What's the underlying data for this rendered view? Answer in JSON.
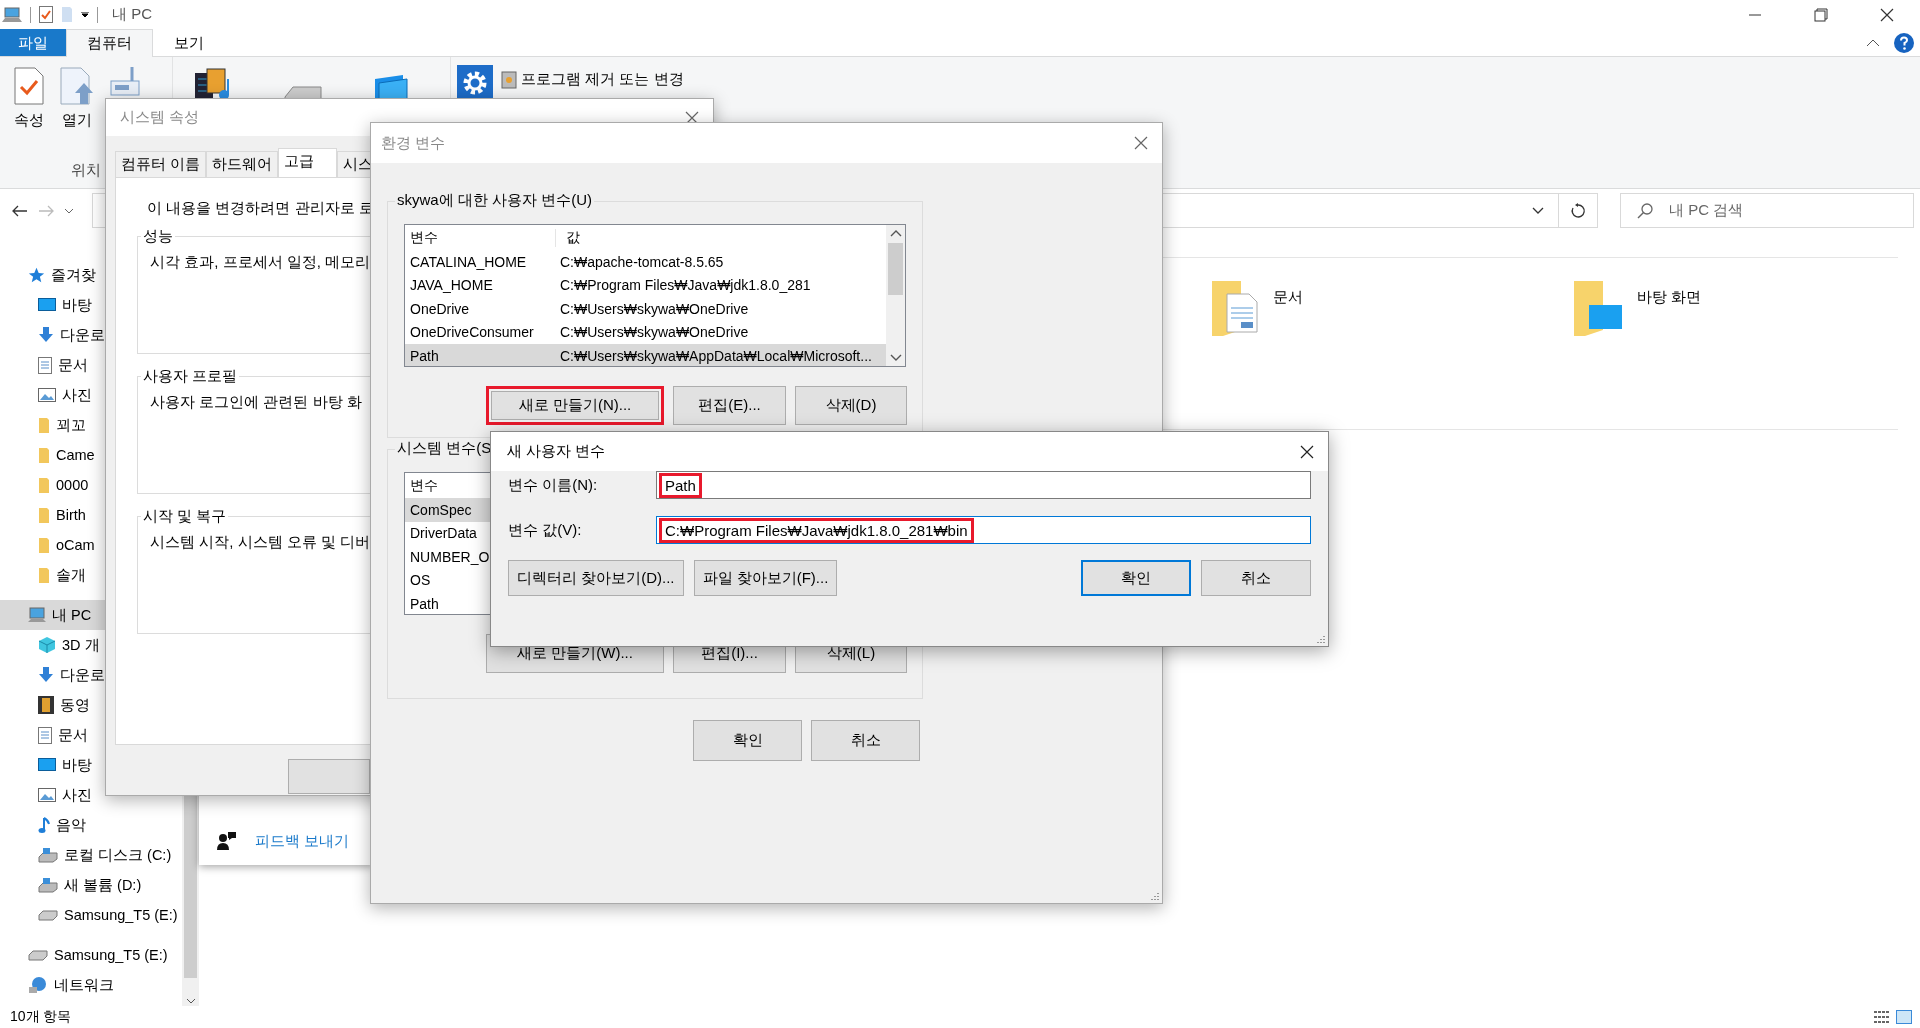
{
  "explorer": {
    "title": "내 PC",
    "ribbon_tabs": [
      {
        "label": "파일",
        "kind": "file",
        "selected": false
      },
      {
        "label": "컴퓨터",
        "kind": "tab",
        "selected": true
      },
      {
        "label": "보기",
        "kind": "tab",
        "selected": false
      }
    ],
    "ribbon_buttons": [
      {
        "label": "속성",
        "kind": "properties"
      },
      {
        "label": "열기",
        "kind": "open"
      }
    ],
    "ribbon_group_label": "위치",
    "ribbon_link": "프로그램 제거 또는 변경",
    "search": {
      "placeholder": "내 PC 검색"
    },
    "sidebar": [
      {
        "label": "즐겨찾",
        "kind": "star",
        "selected": false,
        "children": [
          {
            "label": "바탕",
            "kind": "desktop",
            "selected": false
          },
          {
            "label": "다운로",
            "kind": "download",
            "selected": false
          },
          {
            "label": "문서",
            "kind": "document",
            "selected": false
          },
          {
            "label": "사진",
            "kind": "pictures",
            "selected": false
          },
          {
            "label": "꾀꼬",
            "kind": "folder",
            "selected": false
          },
          {
            "label": "Came",
            "kind": "folder",
            "selected": false
          },
          {
            "label": "0000",
            "kind": "folder",
            "selected": false
          },
          {
            "label": "Birth",
            "kind": "folder",
            "selected": false
          },
          {
            "label": "oCam",
            "kind": "folder",
            "selected": false
          },
          {
            "label": "솔개",
            "kind": "folder",
            "selected": false
          }
        ]
      },
      {
        "label": "내 PC",
        "kind": "pc",
        "selected": true,
        "children": [
          {
            "label": "3D 개",
            "kind": "cube",
            "selected": false
          },
          {
            "label": "다운로",
            "kind": "download",
            "selected": false
          },
          {
            "label": "동영",
            "kind": "video",
            "selected": false
          },
          {
            "label": "문서",
            "kind": "document",
            "selected": false
          },
          {
            "label": "바탕",
            "kind": "desktop",
            "selected": false
          },
          {
            "label": "사진",
            "kind": "pictures",
            "selected": false
          },
          {
            "label": "음악",
            "kind": "music",
            "selected": false
          },
          {
            "label": "로컬 디스크 (C:)",
            "kind": "disk",
            "selected": false
          },
          {
            "label": "새 볼륨 (D:)",
            "kind": "disk",
            "selected": false
          },
          {
            "label": "Samsung_T5 (E:)",
            "kind": "usb",
            "selected": false
          }
        ]
      },
      {
        "label": "Samsung_T5 (E:)",
        "kind": "usb",
        "selected": false
      },
      {
        "label": "네트워크",
        "kind": "network",
        "selected": false
      }
    ],
    "folders": [
      {
        "label": "문서",
        "kind": "documents"
      },
      {
        "label": "바탕 화면",
        "kind": "desktop"
      }
    ],
    "feedback_link": "피드백 보내기",
    "status_bar": "10개 항목"
  },
  "system_properties": {
    "title": "시스템 속성",
    "tabs": [
      {
        "label": "컴퓨터 이름",
        "selected": false
      },
      {
        "label": "하드웨어",
        "selected": false
      },
      {
        "label": "고급",
        "selected": true
      },
      {
        "label": "시스",
        "selected": false
      }
    ],
    "notice": "이 내용을 변경하려면 관리자로 로",
    "groups": [
      {
        "title": "성능",
        "text": "시각 효과, 프로세서 일정, 메모리"
      },
      {
        "title": "사용자 프로필",
        "text": "사용자 로그인에 관련된 바탕 화"
      },
      {
        "title": "시작 및 복구",
        "text": "시스템 시작, 시스템 오류 및 디버"
      }
    ]
  },
  "environment_variables": {
    "title": "환경 변수",
    "user_group": {
      "title": "skywa에 대한 사용자 변수(U)",
      "columns": [
        "변수",
        "값"
      ],
      "rows": [
        {
          "name": "CATALINA_HOME",
          "value": "C:₩apache-tomcat-8.5.65",
          "selected": false
        },
        {
          "name": "JAVA_HOME",
          "value": "C:₩Program Files₩Java₩jdk1.8.0_281",
          "selected": false
        },
        {
          "name": "OneDrive",
          "value": "C:₩Users₩skywa₩OneDrive",
          "selected": false
        },
        {
          "name": "OneDriveConsumer",
          "value": "C:₩Users₩skywa₩OneDrive",
          "selected": false
        },
        {
          "name": "Path",
          "value": "C:₩Users₩skywa₩AppData₩Local₩Microsoft...",
          "selected": true
        }
      ],
      "buttons": [
        {
          "label": "새로 만들기(N)...",
          "highlighted": true
        },
        {
          "label": "편집(E)...",
          "highlighted": false
        },
        {
          "label": "삭제(D)",
          "highlighted": false
        }
      ]
    },
    "system_group": {
      "title": "시스템 변수(S",
      "columns": [
        "변수"
      ],
      "rows": [
        {
          "name": "ComSpec",
          "selected": true
        },
        {
          "name": "DriverData",
          "selected": false
        },
        {
          "name": "NUMBER_O",
          "selected": false
        },
        {
          "name": "OS",
          "selected": false
        },
        {
          "name": "Path",
          "selected": false
        }
      ],
      "buttons": [
        {
          "label": "새로 만들기(W)...",
          "highlighted": false
        },
        {
          "label": "편집(I)...",
          "highlighted": false
        },
        {
          "label": "삭제(L)",
          "highlighted": false
        }
      ]
    },
    "buttons": [
      "확인",
      "취소"
    ]
  },
  "new_variable": {
    "title": "새 사용자 변수",
    "fields": [
      {
        "label": "변수 이름(N):",
        "value": "Path",
        "highlighted": true,
        "focused": false
      },
      {
        "label": "변수 값(V):",
        "value": "C:₩Program Files₩Java₩jdk1.8.0_281₩bin",
        "highlighted": true,
        "focused": true
      }
    ],
    "buttons": [
      {
        "label": "디렉터리 찾아보기(D)...",
        "default": false
      },
      {
        "label": "파일 찾아보기(F)...",
        "default": false
      },
      {
        "label": "확인",
        "default": true
      },
      {
        "label": "취소",
        "default": false
      }
    ]
  }
}
